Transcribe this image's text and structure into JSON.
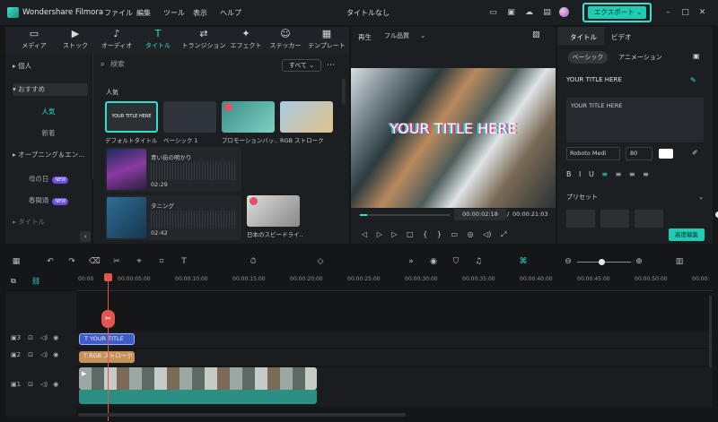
{
  "app": {
    "brand": "Wondershare Filmora",
    "window_title": "タイトルなし",
    "export_label": "エクスポート"
  },
  "menu": [
    "ファイル",
    "編集",
    "ツール",
    "表示",
    "ヘルプ"
  ],
  "media_tabs": [
    {
      "label": "メディア",
      "icon": "media-icon"
    },
    {
      "label": "ストック",
      "icon": "stock-icon"
    },
    {
      "label": "オーディオ",
      "icon": "audio-icon"
    },
    {
      "label": "タイトル",
      "icon": "title-icon",
      "active": true
    },
    {
      "label": "トランジション",
      "icon": "transition-icon"
    },
    {
      "label": "エフェクト",
      "icon": "effect-icon"
    },
    {
      "label": "ステッカー",
      "icon": "sticker-icon"
    },
    {
      "label": "テンプレート",
      "icon": "template-icon"
    }
  ],
  "nav": {
    "personal": "個人",
    "recommended": "おすすめ",
    "popular": "人気",
    "new": "新着",
    "opening": "オープニング＆エン...",
    "mothers_day": "母の日",
    "spring": "春聞通",
    "new_badge": "NEW",
    "title_cat": "タイトル"
  },
  "content": {
    "search_placeholder": "検索",
    "filter": "すべて",
    "section": "人気",
    "items": [
      {
        "label": "デフォルトタイトル",
        "thumb_text": "YOUR TITLE HERE"
      },
      {
        "label": "ベーシック 1"
      },
      {
        "label": "プロモーションバッ..."
      },
      {
        "label": "RGB ストローク"
      }
    ],
    "audio": [
      {
        "title": "青い街の明かり",
        "duration": "02:29"
      },
      {
        "title": "タニング",
        "duration": "02:42"
      }
    ],
    "extra_label": "日本のスピードライ..."
  },
  "player": {
    "label": "再生",
    "quality": "フル品質",
    "current": "00:00:02:18",
    "separator": "/",
    "total": "00:00:21:03",
    "preview_title": "YOUR TITLE HERE",
    "progress": 0.08
  },
  "props": {
    "tab_title": "タイトル",
    "tab_video": "ビデオ",
    "basic": "ベーシック",
    "animation": "アニメーション",
    "layer_name": "YOUR TITLE HERE",
    "text_value": "YOUR TITLE HERE",
    "font": "Roboto Medi",
    "size": "80",
    "preset": "プリセット",
    "advanced": "高度編集"
  },
  "ruler": [
    "00:00",
    "00:00:05:00",
    "00:00:10:00",
    "00:00:15:00",
    "00:00:20:00",
    "00:00:25:00",
    "00:00:30:00",
    "00:00:35:00",
    "00:00:40:00",
    "00:00:45:00",
    "00:00:50:00",
    "00:00:"
  ],
  "tracks": [
    {
      "num": "3"
    },
    {
      "num": "2"
    },
    {
      "num": "1"
    }
  ],
  "clips": {
    "title": "YOUR TITLE",
    "rgb": "RGB ストローク"
  },
  "colors": {
    "accent": "#2fe0cd",
    "export_border": "#35e3d4",
    "title_clip": "#3f5cc9",
    "rgb_clip": "#c8925a",
    "video_audio": "#2c8f83",
    "playhead": "#e0574d"
  }
}
